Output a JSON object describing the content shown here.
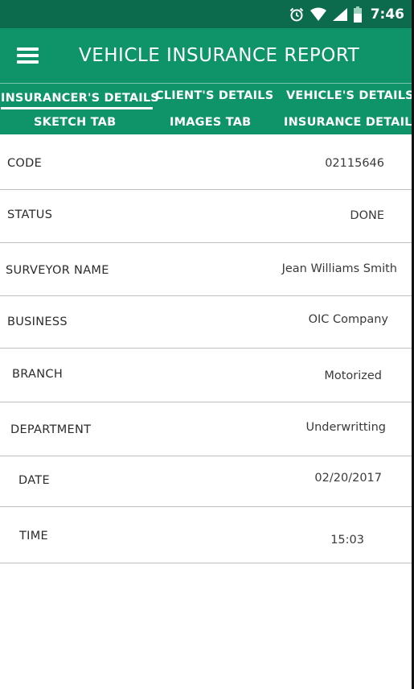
{
  "status_bar": {
    "time": "7:46",
    "icons": [
      "alarm-icon",
      "wifi-icon",
      "signal-icon",
      "battery-icon"
    ]
  },
  "app_bar": {
    "title": "VEHICLE INSURANCE REPORT",
    "menu_icon": "hamburger-menu-icon"
  },
  "tabs": [
    {
      "label": "INSURANCER'S DETAILS",
      "active": true
    },
    {
      "label": "CLIENT'S DETAILS",
      "active": false
    },
    {
      "label": "VEHICLE'S DETAILS",
      "active": false
    },
    {
      "label": "SKETCH TAB",
      "active": false
    },
    {
      "label": "IMAGES TAB",
      "active": false
    },
    {
      "label": "INSURANCE DETAIL",
      "active": false
    }
  ],
  "details": [
    {
      "label": "CODE",
      "value": "02115646"
    },
    {
      "label": "STATUS",
      "value": "DONE"
    },
    {
      "label": "SURVEYOR NAME",
      "value": "Jean Williams Smith"
    },
    {
      "label": "BUSINESS",
      "value": "OIC Company"
    },
    {
      "label": "BRANCH",
      "value": "Motorized"
    },
    {
      "label": "DEPARTMENT",
      "value": "Underwritting"
    },
    {
      "label": "DATE",
      "value": "02/20/2017"
    },
    {
      "label": "TIME",
      "value": "15:03"
    }
  ],
  "colors": {
    "status_bar": "#0b6b4c",
    "primary": "#0e9468",
    "text": "#2b2b2b",
    "divider": "#bdbdbd"
  }
}
